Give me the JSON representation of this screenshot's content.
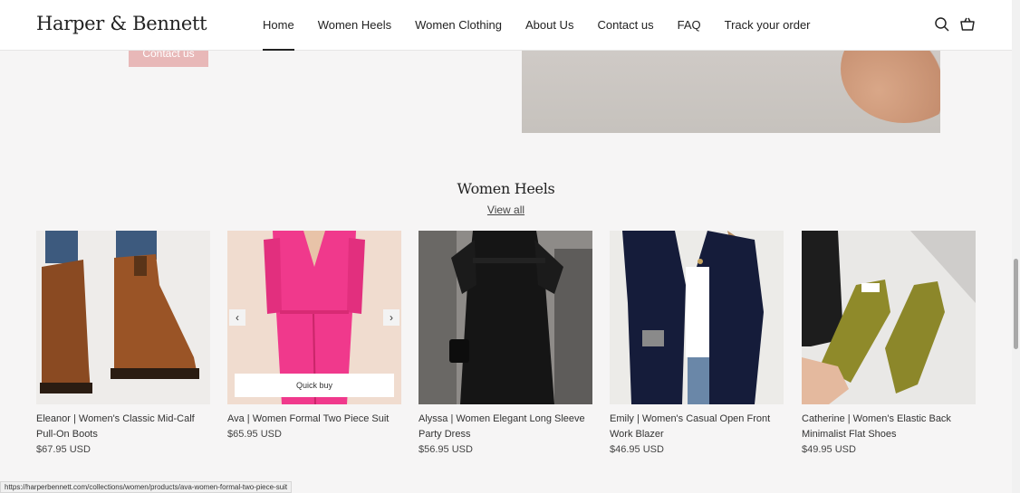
{
  "header": {
    "logo": "Harper & Bennett",
    "nav": [
      "Home",
      "Women Heels",
      "Women Clothing",
      "About Us",
      "Contact us",
      "FAQ",
      "Track your order"
    ],
    "active_index": 0,
    "icons": [
      "search-icon",
      "cart-icon"
    ]
  },
  "hero": {
    "button_label": "Contact us",
    "button_color": "#e8b8b8"
  },
  "section": {
    "title": "Women Heels",
    "view_all": "View all"
  },
  "products": [
    {
      "title": "Eleanor | Women's Classic Mid-Calf Pull-On Boots",
      "price": "$67.95 USD"
    },
    {
      "title": "Ava | Women Formal Two Piece Suit",
      "price": "$65.95 USD",
      "quick_buy": "Quick buy"
    },
    {
      "title": "Alyssa | Women Elegant Long Sleeve Party Dress",
      "price": "$56.95 USD"
    },
    {
      "title": "Emily | Women's Casual Open Front Work Blazer",
      "price": "$46.95 USD"
    },
    {
      "title": "Catherine | Women's Elastic Back Minimalist Flat Shoes",
      "price": "$49.95 USD"
    }
  ],
  "status_bar": {
    "url": "https://harperbennett.com/collections/women/products/ava-women-formal-two-piece-suit"
  }
}
